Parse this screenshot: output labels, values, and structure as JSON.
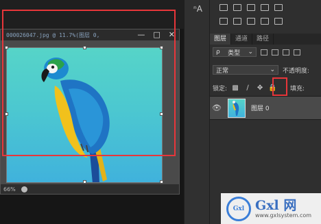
{
  "document": {
    "title": "000026047.jpg @ 11.7%(图层 0,",
    "minimize_label": "—",
    "maximize_label": "□",
    "close_label": "✕",
    "zoom": "66%"
  },
  "toolbar": {
    "tool_icon": "ⁿA"
  },
  "layers_panel": {
    "tabs": [
      {
        "label": "图层"
      },
      {
        "label": "通道"
      },
      {
        "label": "路径"
      }
    ],
    "filter": {
      "prefix": "ρ",
      "value": "类型"
    },
    "blend_mode": "正常",
    "opacity_label": "不透明度:",
    "lock_label": "锁定:",
    "fill_label": "填充:",
    "lock_icons": [
      "▩",
      "∕",
      "✥",
      "🔒"
    ],
    "eye_icon": "👁",
    "layer_name": "图层 0"
  },
  "watermark": {
    "brand": "Gxl 网",
    "url": "www.gxlsystem.com",
    "logo_text": "Gxl"
  },
  "colors": {
    "highlight": "#e8363a",
    "bg_top": "#56d4c8",
    "bg_bottom": "#40b2dc"
  }
}
